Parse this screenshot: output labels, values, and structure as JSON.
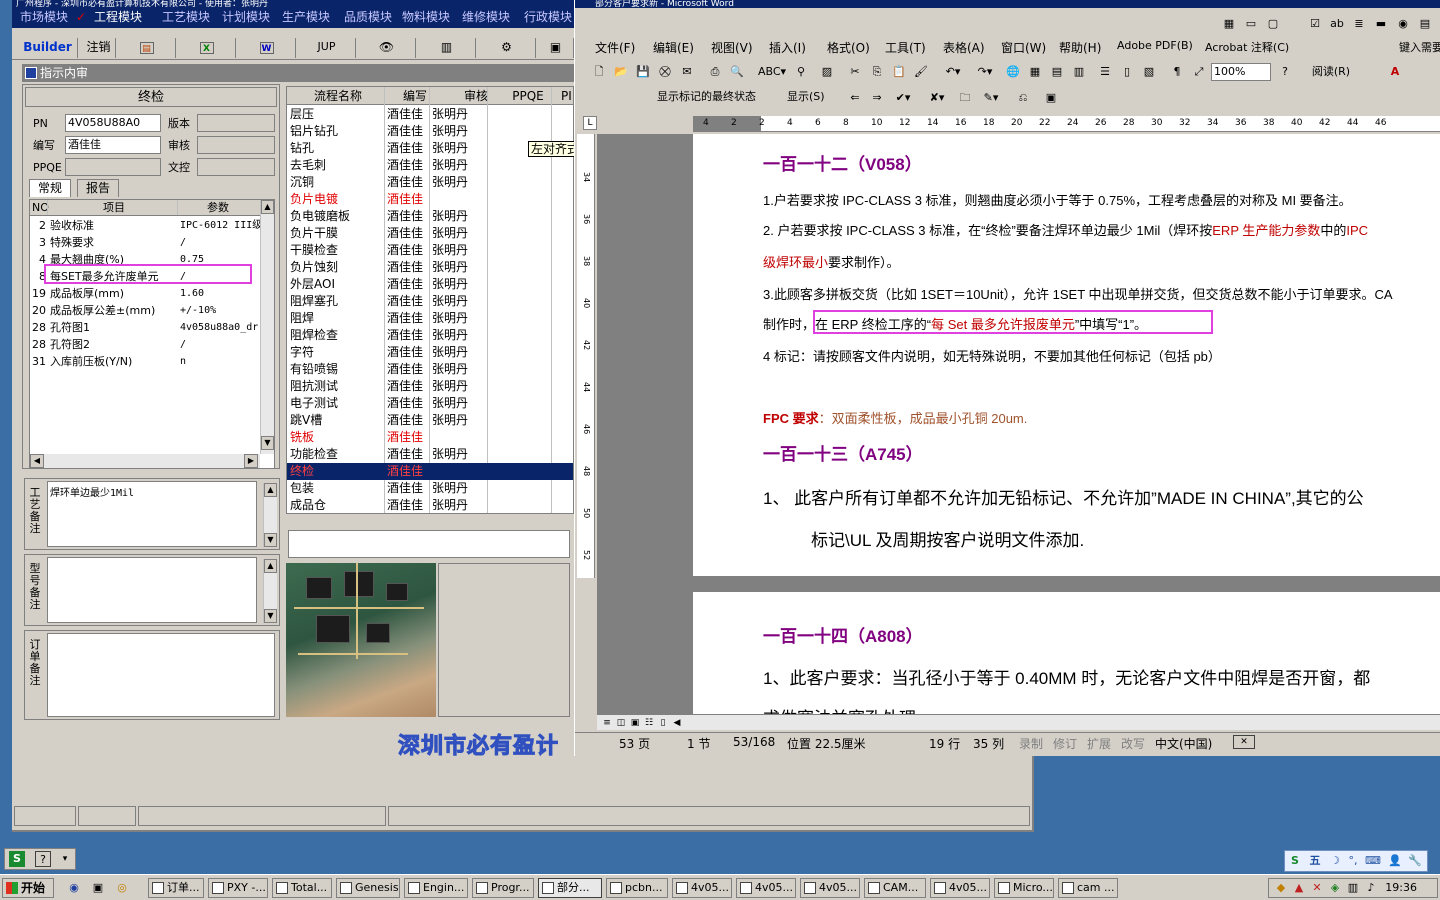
{
  "erp": {
    "title": "广州程序 - 深圳市必有盈计算机技术有限公司 - 使用者：张明丹",
    "modules": [
      "市场模块",
      "工程模块",
      "工艺模块",
      "计划模块",
      "生产模块",
      "品质模块",
      "物料模块",
      "维修模块",
      "行政模块"
    ],
    "active_module_mark": "✓",
    "toolbar": {
      "builder": "Builder",
      "logout": "注销",
      "jup": "JUP"
    },
    "panel_title": "指示内审",
    "process_header": "终检",
    "form": {
      "pn_label": "PN",
      "pn_value": "4V058U88A0",
      "version_label": "版本",
      "version_value": "",
      "editor_label": "编写",
      "editor_value": "酒佳佳",
      "reviewer_label": "审核",
      "reviewer_value": "",
      "ppqe_label": "PPQE",
      "ppqe_value": "",
      "docctl_label": "文控",
      "docctl_value": ""
    },
    "tabs": [
      "常规",
      "报告"
    ],
    "param_headers": [
      "NO",
      "项目",
      "参数"
    ],
    "params": [
      {
        "no": "2",
        "item": "验收标准",
        "value": "IPC-6012 III级"
      },
      {
        "no": "3",
        "item": "特殊要求",
        "value": "/"
      },
      {
        "no": "4",
        "item": "最大翘曲度(%)",
        "value": "0.75"
      },
      {
        "no": "8",
        "item": "每SET最多允许废单元",
        "value": "/"
      },
      {
        "no": "19",
        "item": "成品板厚(mm)",
        "value": "1.60"
      },
      {
        "no": "20",
        "item": "成品板厚公差±(mm)",
        "value": "+/-10%"
      },
      {
        "no": "28",
        "item": "孔符图1",
        "value": "4v058u88a0_dr"
      },
      {
        "no": "28",
        "item": "孔符图2",
        "value": "/"
      },
      {
        "no": "31",
        "item": "入库前压板(Y/N)",
        "value": "n"
      }
    ],
    "flow_headers": [
      "流程名称",
      "编写",
      "审核",
      "PPQE",
      "PI"
    ],
    "flow_rows": [
      {
        "name": "层压",
        "editor": "酒佳佳",
        "reviewer": "张明丹",
        "state": "normal"
      },
      {
        "name": "铝片钻孔",
        "editor": "酒佳佳",
        "reviewer": "张明丹",
        "state": "normal"
      },
      {
        "name": "钻孔",
        "editor": "酒佳佳",
        "reviewer": "张明丹",
        "state": "normal"
      },
      {
        "name": "去毛刺",
        "editor": "酒佳佳",
        "reviewer": "张明丹",
        "state": "normal"
      },
      {
        "name": "沉铜",
        "editor": "酒佳佳",
        "reviewer": "张明丹",
        "state": "normal"
      },
      {
        "name": "负片电镀",
        "editor": "酒佳佳",
        "reviewer": "",
        "state": "red"
      },
      {
        "name": "负电镀磨板",
        "editor": "酒佳佳",
        "reviewer": "张明丹",
        "state": "normal"
      },
      {
        "name": "负片干膜",
        "editor": "酒佳佳",
        "reviewer": "张明丹",
        "state": "normal"
      },
      {
        "name": "干膜检查",
        "editor": "酒佳佳",
        "reviewer": "张明丹",
        "state": "normal"
      },
      {
        "name": "负片蚀刻",
        "editor": "酒佳佳",
        "reviewer": "张明丹",
        "state": "normal"
      },
      {
        "name": "外层AOI",
        "editor": "酒佳佳",
        "reviewer": "张明丹",
        "state": "normal"
      },
      {
        "name": "阻焊塞孔",
        "editor": "酒佳佳",
        "reviewer": "张明丹",
        "state": "normal"
      },
      {
        "name": "阻焊",
        "editor": "酒佳佳",
        "reviewer": "张明丹",
        "state": "normal"
      },
      {
        "name": "阻焊检查",
        "editor": "酒佳佳",
        "reviewer": "张明丹",
        "state": "normal"
      },
      {
        "name": "字符",
        "editor": "酒佳佳",
        "reviewer": "张明丹",
        "state": "normal"
      },
      {
        "name": "有铅喷锡",
        "editor": "酒佳佳",
        "reviewer": "张明丹",
        "state": "normal"
      },
      {
        "name": "阻抗测试",
        "editor": "酒佳佳",
        "reviewer": "张明丹",
        "state": "normal"
      },
      {
        "name": "电子测试",
        "editor": "酒佳佳",
        "reviewer": "张明丹",
        "state": "normal"
      },
      {
        "name": "跳V槽",
        "editor": "酒佳佳",
        "reviewer": "张明丹",
        "state": "normal"
      },
      {
        "name": "铣板",
        "editor": "酒佳佳",
        "reviewer": "",
        "state": "red"
      },
      {
        "name": "功能检查",
        "editor": "酒佳佳",
        "reviewer": "张明丹",
        "state": "normal"
      },
      {
        "name": "终检",
        "editor": "酒佳佳",
        "reviewer": "",
        "state": "selected"
      },
      {
        "name": "包装",
        "editor": "酒佳佳",
        "reviewer": "张明丹",
        "state": "normal"
      },
      {
        "name": "成品仓",
        "editor": "酒佳佳",
        "reviewer": "张明丹",
        "state": "normal"
      }
    ],
    "remarks": {
      "process_label": "工艺备注",
      "process_text": "焊环单边最少1Mil",
      "model_label": "型号备注",
      "order_label": "订单备注"
    },
    "watermark": "深圳市必有盈计",
    "tooltip": "左对齐式制表符"
  },
  "word": {
    "title": "部分客户要求新 - Microsoft Word",
    "menu": [
      "文件(F)",
      "编辑(E)",
      "视图(V)",
      "插入(I)",
      "格式(O)",
      "工具(T)",
      "表格(A)",
      "窗口(W)",
      "帮助(H)",
      "Adobe PDF(B)",
      "Acrobat 注释(C)"
    ],
    "help_box": "键入需要",
    "zoom": "100%",
    "read_label": "阅读(R)",
    "markup_combo": "显示标记的最终状态",
    "show_label": "显示(S)",
    "ruler_ticks": [
      "4",
      "2",
      "2",
      "4",
      "6",
      "8",
      "10",
      "12",
      "14",
      "16",
      "18",
      "20",
      "22",
      "24",
      "26",
      "28",
      "30",
      "32",
      "34",
      "36",
      "38",
      "40",
      "42",
      "44",
      "46"
    ],
    "vruler_ticks": [
      "34",
      "36",
      "38",
      "40",
      "42",
      "44",
      "46",
      "48",
      "50",
      "52"
    ],
    "doc": {
      "s112_title": "一百一十二（V058）",
      "s112_p1": "1.户若要求按 IPC-CLASS 3 标准，则翘曲度必须小于等于 0.75%，工程考虑叠层的对称及 MI 要备注。",
      "s112_p2a": "2. 户若要求按 IPC-CLASS 3 标准，在“终检”要备注焊环单边最少 1Mil（焊环按",
      "s112_p2b": "ERP 生产能力参数",
      "s112_p2c": "中的",
      "s112_p2d": "IPC",
      "s112_p2e": "级焊环最小",
      "s112_p2f": "要求制作）。",
      "s112_p3": "3.此顾客多拼板交货（比如 1SET＝10Unit），允许 1SET 中出现单拼交货，但交货总数不能小于订单要求。CA",
      "s112_p3b_pre": "制作时，",
      "s112_p3b_a": "在 ERP 终检工序的“",
      "s112_p3b_b": "每 Set 最多允许报废单元",
      "s112_p3b_c": "”中填写“1”。",
      "s112_p4": "4 标记：请按顾客文件内说明，如无特殊说明，不要加其他任何标记（包括  pb）",
      "fpc_label": "FPC 要求",
      "fpc_text": "：双面柔性板，成品最小孔铜 20um.",
      "s113_title": "一百一十三（A745）",
      "s113_p1": "1、    此客户所有订单都不允许加无铅标记、不允许加”MADE IN CHINA”,其它的公",
      "s113_p1b": "标记\\UL 及周期按客户说明文件添加.",
      "s114_title": "一百一十四（A808）",
      "s114_p1": "1、此客户要求：当孔径小于等于  0.40MM  时，无论客户文件中阻焊是否开窗，都",
      "s114_p1b": "求做塞油并塞孔处理"
    },
    "status": {
      "page": "53 页",
      "section": "1 节",
      "pos": "53/168",
      "at": "位置 22.5厘米",
      "line": "19 行",
      "col": "35 列",
      "rec": "录制",
      "trk": "修订",
      "ext": "扩展",
      "ovr": "改写",
      "lang": "中文(中国)"
    }
  },
  "langbar": {
    "chars": "五",
    "start": "开始"
  },
  "taskbar": {
    "start_label": "开始",
    "tasks": [
      "订单...",
      "PXY -...",
      "Total...",
      "Genesis",
      "Engin...",
      "Progr...",
      "部分...",
      "pcbn...",
      "4v05...",
      "4v05...",
      "4v05...",
      "CAM...",
      "4v05...",
      "Micro...",
      "cam ..."
    ],
    "clock": "19:36"
  },
  "colors": {
    "accent": "#0a246a",
    "highlight": "#e040e0",
    "heading": "#800080",
    "alert": "#c00000"
  }
}
